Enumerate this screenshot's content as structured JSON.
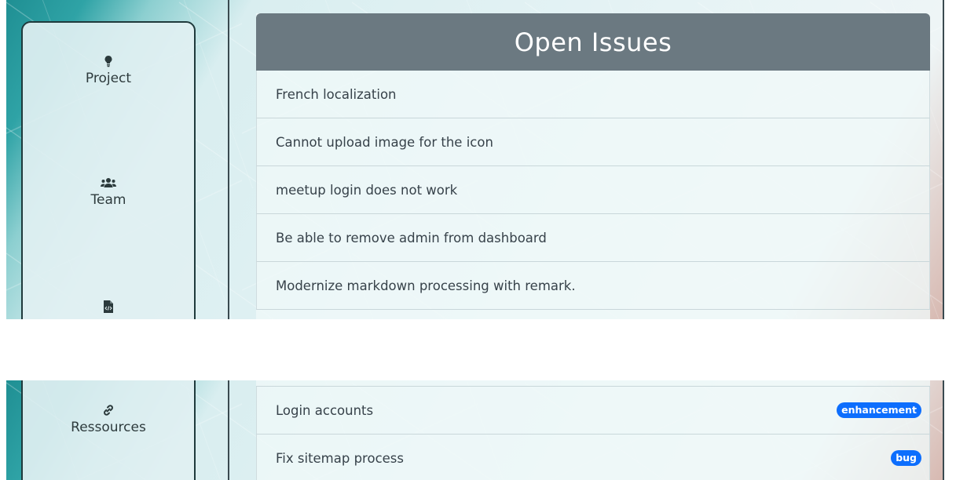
{
  "sidebar": {
    "items": [
      {
        "label": "Project",
        "icon": "lightbulb-icon"
      },
      {
        "label": "Team",
        "icon": "users-icon"
      },
      {
        "label": "",
        "icon": "file-code-icon"
      },
      {
        "label": "Ressources",
        "icon": "link-icon"
      }
    ]
  },
  "issues": {
    "title": "Open Issues",
    "top_list": [
      {
        "title": "French localization"
      },
      {
        "title": "Cannot upload image for the icon"
      },
      {
        "title": "meetup login does not work"
      },
      {
        "title": "Be able to remove admin from dashboard"
      },
      {
        "title": "Modernize markdown processing with remark."
      }
    ],
    "bottom_list": [
      {
        "title": "Login accounts",
        "label": "enhancement"
      },
      {
        "title": "Fix sitemap process",
        "label": "bug"
      }
    ]
  },
  "colors": {
    "header_bg": "#5f6e76",
    "badge_bg": "#0d6efd",
    "teal_accent": "#2fa3a6"
  }
}
